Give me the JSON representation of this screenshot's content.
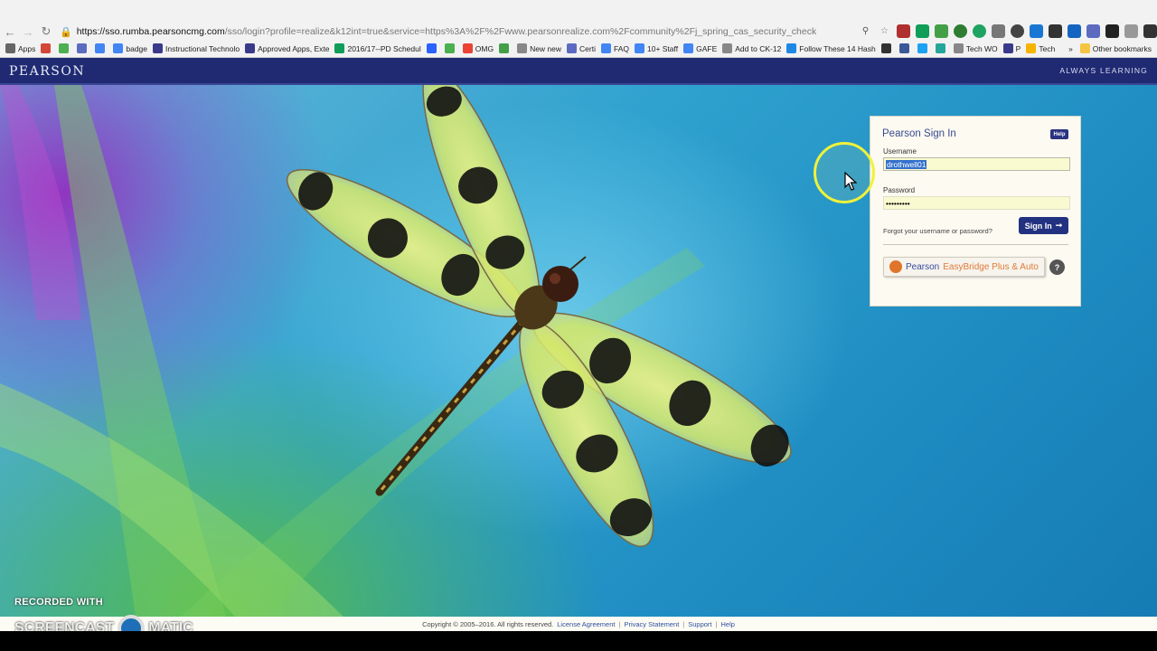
{
  "browser": {
    "url_host": "https://sso.rumba.pearsoncmg.com",
    "url_rest": "/sso/login?profile=realize&k12int=true&service=https%3A%2F%2Fwww.pearsonrealize.com%2Fcommunity%2Fj_spring_cas_security_check",
    "bookmarks": [
      {
        "label": "Apps",
        "color": "#666"
      },
      {
        "label": "",
        "color": "#d44638"
      },
      {
        "label": "",
        "color": "#4caf50"
      },
      {
        "label": "",
        "color": "#5c6bc0"
      },
      {
        "label": "",
        "color": "#4285f4"
      },
      {
        "label": "badge",
        "color": "#4285f4"
      },
      {
        "label": "Instructional Technolo",
        "color": "#3a3a8a"
      },
      {
        "label": "Approved Apps, Exte",
        "color": "#3a3a8a"
      },
      {
        "label": "2016/17--PD Schedul",
        "color": "#0f9d58"
      },
      {
        "label": "",
        "color": "#2962ff"
      },
      {
        "label": "",
        "color": "#4caf50"
      },
      {
        "label": "OMG",
        "color": "#ea4335"
      },
      {
        "label": "",
        "color": "#43a047"
      },
      {
        "label": "New new",
        "color": "#888"
      },
      {
        "label": "Certi",
        "color": "#5c6bc0"
      },
      {
        "label": "FAQ",
        "color": "#4285f4"
      },
      {
        "label": "10+ Staff",
        "color": "#4285f4"
      },
      {
        "label": "GAFE",
        "color": "#4285f4"
      },
      {
        "label": "Add to CK-12",
        "color": "#888"
      },
      {
        "label": "Follow These 14 Hash",
        "color": "#1e88e5"
      },
      {
        "label": "",
        "color": "#333"
      },
      {
        "label": "",
        "color": "#3b5998"
      },
      {
        "label": "",
        "color": "#1da1f2"
      },
      {
        "label": "",
        "color": "#26a69a"
      },
      {
        "label": "Tech WO",
        "color": "#888"
      },
      {
        "label": "P",
        "color": "#3a3a8a"
      },
      {
        "label": "Tech",
        "color": "#f4b400"
      }
    ],
    "other_bookmarks": "Other bookmarks",
    "bookmarks_overflow": "»"
  },
  "header": {
    "logo": "PEARSON",
    "tagline": "ALWAYS LEARNING"
  },
  "signin": {
    "title": "Pearson Sign In",
    "help": "Help",
    "username_label": "Username",
    "username_value": "drothwell01",
    "password_label": "Password",
    "password_value": "•••••••••",
    "forgot": "Forgot your username or password?",
    "signin_button": "Sign In",
    "easybridge_brand": "Pearson",
    "easybridge_label": "EasyBridge Plus & Auto",
    "question": "?"
  },
  "footer": {
    "copyright": "Copyright © 2005–2016. All rights reserved.",
    "license": "License Agreement",
    "privacy": "Privacy Statement",
    "support": "Support",
    "help": "Help"
  },
  "watermark": {
    "line1": "RECORDED WITH",
    "line2a": "SCREENCAST",
    "line2b": "MATIC"
  }
}
